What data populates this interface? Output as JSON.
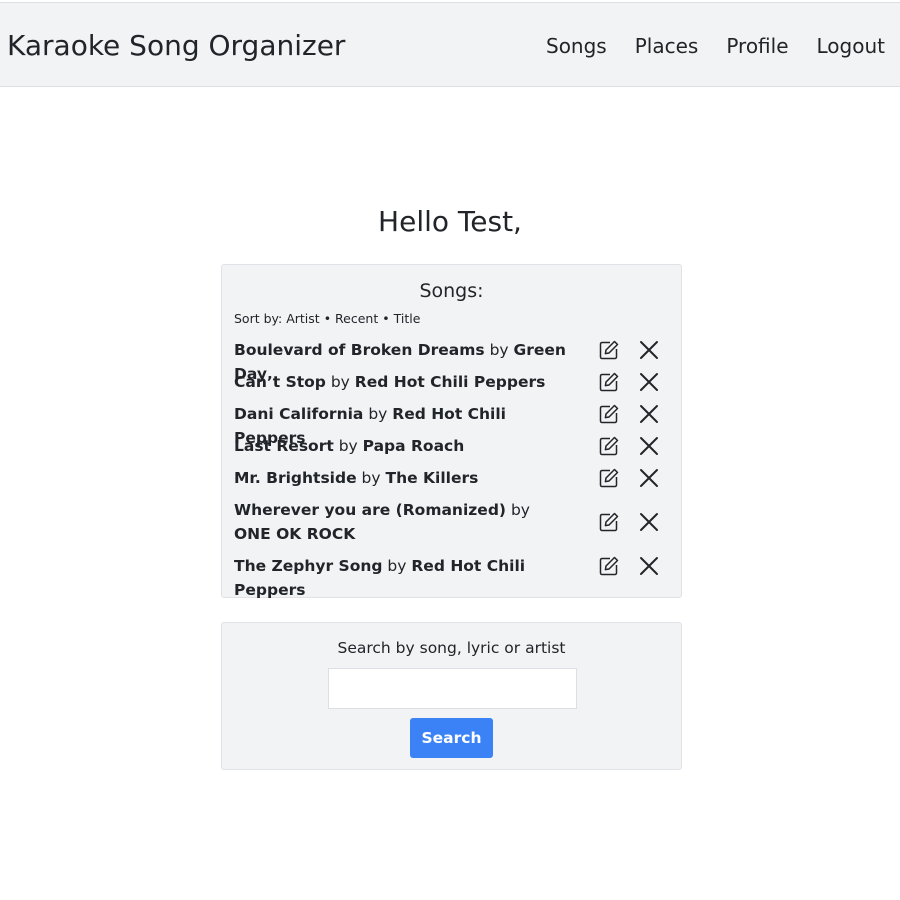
{
  "app_title": "Karaoke Song Organizer",
  "nav": {
    "items": [
      {
        "label": "Songs"
      },
      {
        "label": "Places"
      },
      {
        "label": "Profile"
      },
      {
        "label": "Logout"
      }
    ]
  },
  "greeting": "Hello Test,",
  "songs_panel": {
    "title": "Songs:",
    "sort_label": "Sort by:",
    "sort_options": [
      "Artist",
      "Recent",
      "Title"
    ],
    "separator": "•",
    "by_word": "by",
    "songs": [
      {
        "title": "Boulevard of Broken Dreams",
        "artist": "Green Day"
      },
      {
        "title": "Can’t Stop",
        "artist": "Red Hot Chili Peppers"
      },
      {
        "title": "Dani California",
        "artist": "Red Hot Chili Peppers"
      },
      {
        "title": "Last Resort",
        "artist": "Papa Roach"
      },
      {
        "title": "Mr. Brightside",
        "artist": "The Killers"
      },
      {
        "title": "Wherever you are (Romanized)",
        "artist": "ONE OK ROCK"
      },
      {
        "title": "The Zephyr Song",
        "artist": "Red Hot Chili Peppers"
      }
    ],
    "row_icons": [
      "edit-icon",
      "delete-x-icon"
    ]
  },
  "search_panel": {
    "label": "Search by song, lyric or artist",
    "input_value": "",
    "button_label": "Search",
    "button_color": "#3b82f6"
  }
}
